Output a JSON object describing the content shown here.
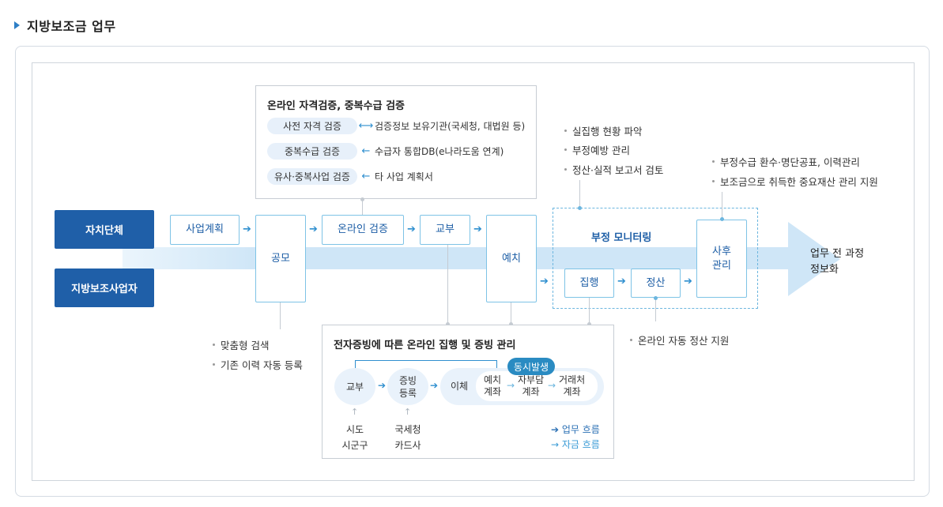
{
  "header": {
    "title": "지방보조금 업무"
  },
  "actors": {
    "top": "자치단체",
    "bottom": "지방보조사업자"
  },
  "process": {
    "plan": "사업계획",
    "announce": "공모",
    "online_verify": "온라인 검증",
    "grant": "교부",
    "deposit": "예치",
    "monitoring_title": "부정 모니터링",
    "execute": "집행",
    "settle": "정산",
    "after_mgmt": "사후\n관리",
    "final": "업무 전 과정\n정보화",
    "arrow": "➔"
  },
  "verify_panel": {
    "title": "온라인 자격검증, 중복수급 검증",
    "rows": [
      {
        "label": "사전 자격 검증",
        "symbol": "⟷",
        "desc": "검증정보 보유기관(국세청, 대법원 등)"
      },
      {
        "label": "중복수급 검증",
        "symbol": "←",
        "desc": "수급자 통합DB(e나라도움 연계)"
      },
      {
        "label": "유사·중복사업 검증",
        "symbol": "←",
        "desc": "타 사업 계획서"
      }
    ]
  },
  "notes": {
    "announce": [
      "맞춤형 검색",
      "기존 이력 자동 등록"
    ],
    "monitoring": [
      "실집행 현황 파악",
      "부정예방 관리",
      "정산·실적 보고서 검토"
    ],
    "after": [
      "부정수급 환수·명단공표, 이력관리",
      "보조금으로 취득한 중요재산 관리 지원"
    ],
    "settle": [
      "온라인 자동 정산 지원"
    ]
  },
  "evidence_panel": {
    "title": "전자증빙에 따른 온라인 집행 및 증빙 관리",
    "grant": "교부",
    "evidence": "증빙\n등록",
    "transfer": "이체",
    "badge": "동시발생",
    "accounts": [
      "예치\n계좌",
      "자부담\n계좌",
      "거래처\n계좌"
    ],
    "src_grant": "시도\n시군구",
    "src_evidence": "국세청\n카드사",
    "legend_work": "➔ 업무 흐름",
    "legend_fund": "→ 자금 흐름"
  },
  "colors": {
    "primary": "#1f5fa8",
    "accent": "#2f8fcf",
    "band": "#cfe6f7"
  }
}
